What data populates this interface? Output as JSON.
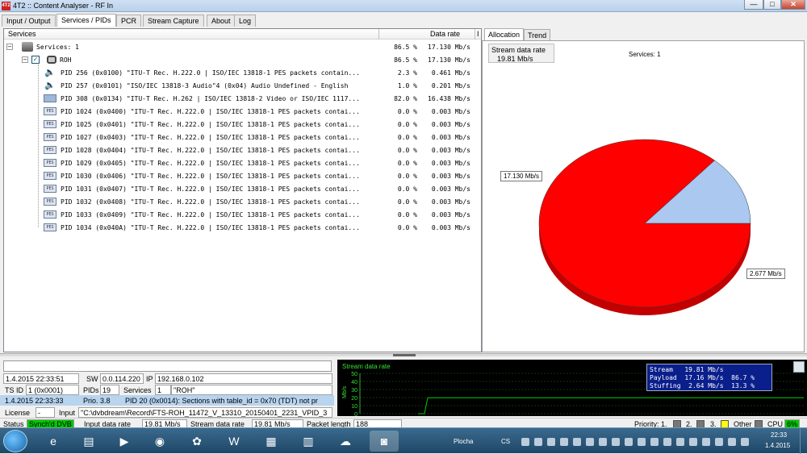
{
  "window": {
    "app_icon_text": "4T2",
    "title": "4T2 :: Content Analyser - RF In",
    "minimize": "—",
    "maximize": "□",
    "close": "✕"
  },
  "tabs": [
    "Input / Output",
    "Services / PIDs",
    "PCR",
    "Stream Capture",
    "About",
    "Log"
  ],
  "tree": {
    "col_services": "Services",
    "col_rate": "Data rate",
    "col_extra": "I",
    "services_root": {
      "label": "Services: 1",
      "pct": "86.5 %",
      "rate": "17.130 Mb/s"
    },
    "service": {
      "label": "ROH",
      "pct": "86.5 %",
      "rate": "17.130 Mb/s"
    },
    "pids": [
      {
        "label": "PID 256 (0x0100) \"ITU-T Rec. H.222.0 | ISO/IEC 13818-1 PES packets contain...",
        "pct": "2.3 %",
        "rate": "0.461 Mb/s",
        "icon": "speaker-icon"
      },
      {
        "label": "PID 257 (0x0101) \"ISO/IEC 13818-3 Audio\"4 (0x04) Audio Undefined - English",
        "pct": "1.0 %",
        "rate": "0.201 Mb/s",
        "icon": "speaker-icon"
      },
      {
        "label": "PID 308 (0x0134) \"ITU-T Rec. H.262 | ISO/IEC 13818-2 Video or ISO/IEC 1117...",
        "pct": "82.0 %",
        "rate": "16.438 Mb/s",
        "icon": "monitor-icon"
      },
      {
        "label": "PID 1024 (0x0400) \"ITU-T Rec. H.222.0 | ISO/IEC 13818-1 PES packets contai...",
        "pct": "0.0 %",
        "rate": "0.003 Mb/s",
        "icon": "pes-icon"
      },
      {
        "label": "PID 1025 (0x0401) \"ITU-T Rec. H.222.0 | ISO/IEC 13818-1 PES packets contai...",
        "pct": "0.0 %",
        "rate": "0.003 Mb/s",
        "icon": "pes-icon"
      },
      {
        "label": "PID 1027 (0x0403) \"ITU-T Rec. H.222.0 | ISO/IEC 13818-1 PES packets contai...",
        "pct": "0.0 %",
        "rate": "0.003 Mb/s",
        "icon": "pes-icon"
      },
      {
        "label": "PID 1028 (0x0404) \"ITU-T Rec. H.222.0 | ISO/IEC 13818-1 PES packets contai...",
        "pct": "0.0 %",
        "rate": "0.003 Mb/s",
        "icon": "pes-icon"
      },
      {
        "label": "PID 1029 (0x0405) \"ITU-T Rec. H.222.0 | ISO/IEC 13818-1 PES packets contai...",
        "pct": "0.0 %",
        "rate": "0.003 Mb/s",
        "icon": "pes-icon"
      },
      {
        "label": "PID 1030 (0x0406) \"ITU-T Rec. H.222.0 | ISO/IEC 13818-1 PES packets contai...",
        "pct": "0.0 %",
        "rate": "0.003 Mb/s",
        "icon": "pes-icon"
      },
      {
        "label": "PID 1031 (0x0407) \"ITU-T Rec. H.222.0 | ISO/IEC 13818-1 PES packets contai...",
        "pct": "0.0 %",
        "rate": "0.003 Mb/s",
        "icon": "pes-icon"
      },
      {
        "label": "PID 1032 (0x0408) \"ITU-T Rec. H.222.0 | ISO/IEC 13818-1 PES packets contai...",
        "pct": "0.0 %",
        "rate": "0.003 Mb/s",
        "icon": "pes-icon"
      },
      {
        "label": "PID 1033 (0x0409) \"ITU-T Rec. H.222.0 | ISO/IEC 13818-1 PES packets contai...",
        "pct": "0.0 %",
        "rate": "0.003 Mb/s",
        "icon": "pes-icon"
      },
      {
        "label": "PID 1034 (0x040A) \"ITU-T Rec. H.222.0 | ISO/IEC 13818-1 PES packets contai...",
        "pct": "0.0 %",
        "rate": "0.003 Mb/s",
        "icon": "pes-icon"
      }
    ]
  },
  "right_tabs": [
    "Allocation",
    "Trend"
  ],
  "allocation": {
    "stream_rate_label": "Stream data rate",
    "stream_rate_value": "19.81 Mb/s",
    "services_label": "Services: 1"
  },
  "chart_data": [
    {
      "type": "pie",
      "slices": [
        {
          "label": "17.130 Mb/s",
          "value": 17.13,
          "color": "#ff0000"
        },
        {
          "label": "2.677 Mb/s",
          "value": 2.677,
          "color": "#aac8f0"
        }
      ]
    },
    {
      "type": "line",
      "title": "Stream data rate",
      "ylabel": "Mb/s",
      "yticks": [
        "50",
        "40",
        "30",
        "20",
        "10",
        "0"
      ],
      "ylim": [
        0,
        50
      ],
      "series": [
        {
          "name": "Stream",
          "values": [
            0,
            0,
            19.81,
            19.81,
            19.81,
            19.81,
            19.81,
            19.81
          ],
          "color": "#00cc00"
        }
      ],
      "legend": "top-right"
    }
  ],
  "legend": {
    "stream": "Stream   19.81 Mb/s",
    "payload": "Payload  17.16 Mb/s  86.7 %",
    "stuffing": "Stuffing  2.64 Mb/s  13.3 %"
  },
  "info": {
    "timestamp": "1.4.2015 22:33:51",
    "sw_label": "SW",
    "sw_value": "0.0.114.220",
    "ip_label": "IP",
    "ip_value": "192.168.0.102",
    "tsid_label": "TS ID",
    "tsid_value": "1 (0x0001)",
    "pids_label": "PIDs",
    "pids_value": "19",
    "services_label": "Services",
    "services_value": "1",
    "service_name": "\"ROH\"",
    "log_time": "1.4.2015 22:33:33",
    "log_prio": "Prio. 3.8",
    "log_msg": "PID 20 (0x0014): Sections with table_id = 0x70 (TDT) not pr",
    "license_label": "License",
    "license_value": "-",
    "input_label": "Input",
    "input_value": "\"C:\\dvbdream\\Record\\FTS-ROH_11472_V_13310_20150401_2231_VPID_3"
  },
  "status": {
    "status_label": "Status",
    "status_value": "Synch'd DVB",
    "input_rate_label": "Input data rate",
    "input_rate_value": "19.81 Mb/s",
    "stream_rate_label": "Stream data rate",
    "stream_rate_value": "19.81 Mb/s",
    "packet_label": "Packet length",
    "packet_value": "188",
    "priority_label": "Priority: 1.",
    "p2": "2.",
    "p3": "3.",
    "other": "Other",
    "cpu_label": "CPU",
    "cpu_value": "6%"
  },
  "taskbar": {
    "desktop": "Plocha",
    "lang": "CS",
    "time": "22:33",
    "date": "1.4.2015"
  },
  "colors": {
    "pie_primary": "#ff0000",
    "pie_secondary": "#aac8f0",
    "status_ok": "#00c800",
    "graph_line": "#00cc00"
  }
}
